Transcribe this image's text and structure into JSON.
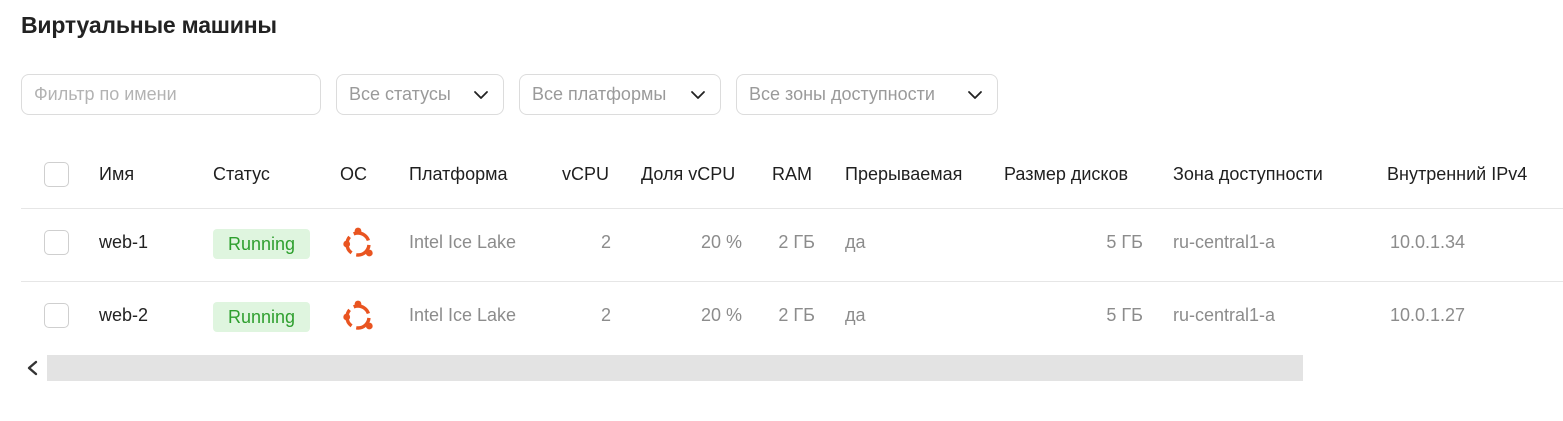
{
  "page": {
    "title": "Виртуальные машины"
  },
  "filters": {
    "name_placeholder": "Фильтр по имени",
    "name_value": "",
    "status": "Все статусы",
    "platform": "Все платформы",
    "zone": "Все зоны доступности"
  },
  "table": {
    "headers": {
      "name": "Имя",
      "status": "Статус",
      "os": "ОС",
      "platform": "Платформа",
      "vcpu": "vCPU",
      "vcpu_share": "Доля vCPU",
      "ram": "RAM",
      "preemptible": "Прерываемая",
      "disk_size": "Размер дисков",
      "zone": "Зона доступности",
      "ipv4": "Внутренний IPv4"
    },
    "rows": [
      {
        "name": "web-1",
        "status": "Running",
        "os_icon": "ubuntu-icon",
        "platform": "Intel Ice Lake",
        "vcpu": "2",
        "vcpu_share": "20 %",
        "ram": "2 ГБ",
        "preemptible": "да",
        "disk_size": "5 ГБ",
        "zone": "ru-central1-a",
        "ipv4": "10.0.1.34"
      },
      {
        "name": "web-2",
        "status": "Running",
        "os_icon": "ubuntu-icon",
        "platform": "Intel Ice Lake",
        "vcpu": "2",
        "vcpu_share": "20 %",
        "ram": "2 ГБ",
        "preemptible": "да",
        "disk_size": "5 ГБ",
        "zone": "ru-central1-a",
        "ipv4": "10.0.1.27"
      }
    ]
  },
  "colors": {
    "status_running_bg": "#dff5df",
    "status_running_text": "#2e9f2e",
    "ubuntu_orange": "#e95420"
  }
}
